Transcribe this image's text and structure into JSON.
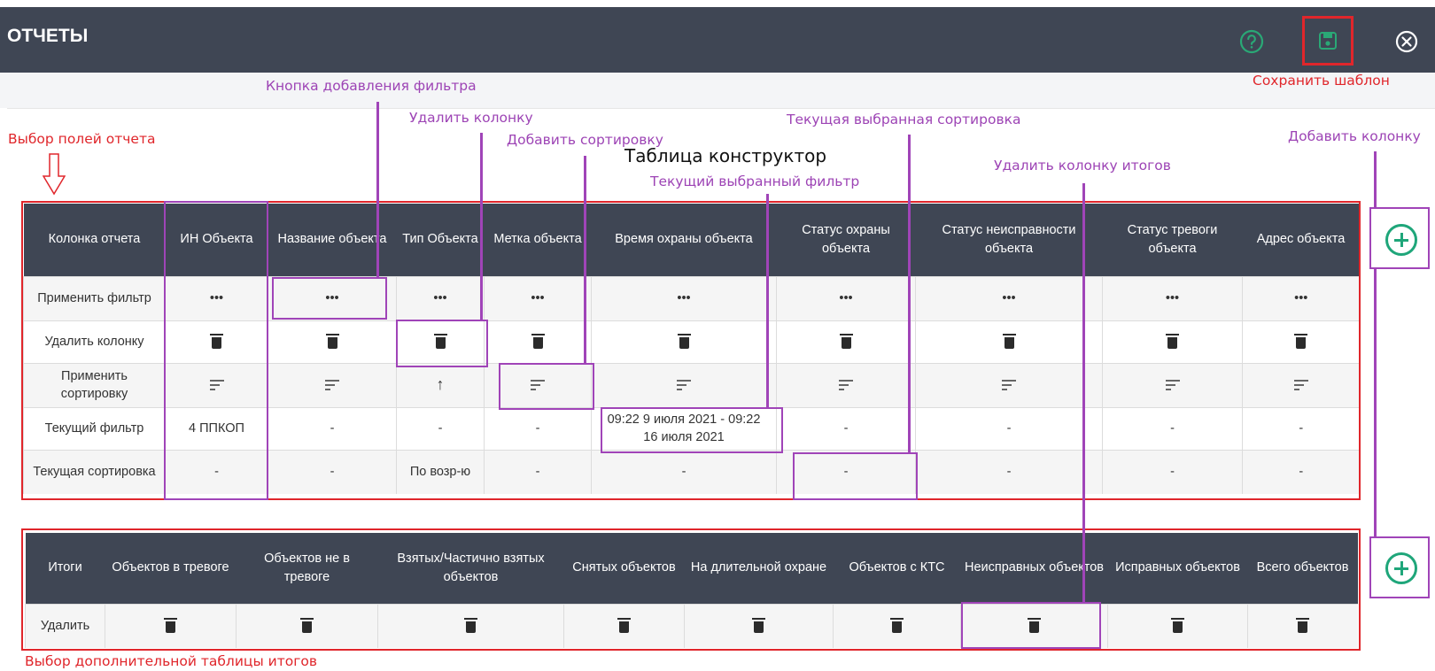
{
  "header": {
    "title": "ОТЧЕТЫ"
  },
  "annotations": {
    "add_filter_button": "Кнопка добавления фильтра",
    "save_template": "Сохранить шаблон",
    "delete_column": "Удалить колонку",
    "current_sort": "Текущая выбранная сортировка",
    "select_report_fields": "Выбор полей отчета",
    "add_sort": "Добавить сортировку",
    "add_column": "Добавить колонку",
    "constructor_table": "Таблица конструктор",
    "delete_totals_column": "Удалить колонку итогов",
    "current_filter": "Текущий выбранный фильтр",
    "select_totals_table": "Выбор дополнительной таблицы итогов"
  },
  "report_table": {
    "corner_header": "Колонка отчета",
    "columns": [
      "ИН Объекта",
      "Название объекта",
      "Тип Объекта",
      "Метка объекта",
      "Время охраны объекта",
      "Статус охраны объекта",
      "Статус неисправности объекта",
      "Статус тревоги объекта",
      "Адрес объекта"
    ],
    "row_labels": [
      "Применить фильтр",
      "Удалить колонку",
      "Применить сортировку",
      "Текущий фильтр",
      "Текущая сортировка"
    ],
    "filter_glyph": "•••",
    "sort_asc_glyph": "↑",
    "current_filter_values": [
      "4 ППКОП",
      "-",
      "-",
      "-",
      "09:22 9 июля 2021 - 09:22 16 июля 2021",
      "-",
      "-",
      "-",
      "-"
    ],
    "current_sort_values": [
      "-",
      "-",
      "По возр-ю",
      "-",
      "-",
      "-",
      "-",
      "-",
      "-"
    ]
  },
  "totals_table": {
    "corner_header": "Итоги",
    "columns": [
      "Объектов в тревоге",
      "Объектов не в тревоге",
      "Взятых/Частично взятых объектов",
      "Снятых объектов",
      "На длительной охране",
      "Объектов с КТС",
      "Неисправных объектов",
      "Исправных объектов",
      "Всего объектов"
    ],
    "row_label": "Удалить"
  },
  "colors": {
    "header_bg": "#3f4654",
    "annotation_purple": "#9d44b5",
    "annotation_red": "#e0262b",
    "add_green": "#1fa67a",
    "help_green": "#2aa876"
  }
}
